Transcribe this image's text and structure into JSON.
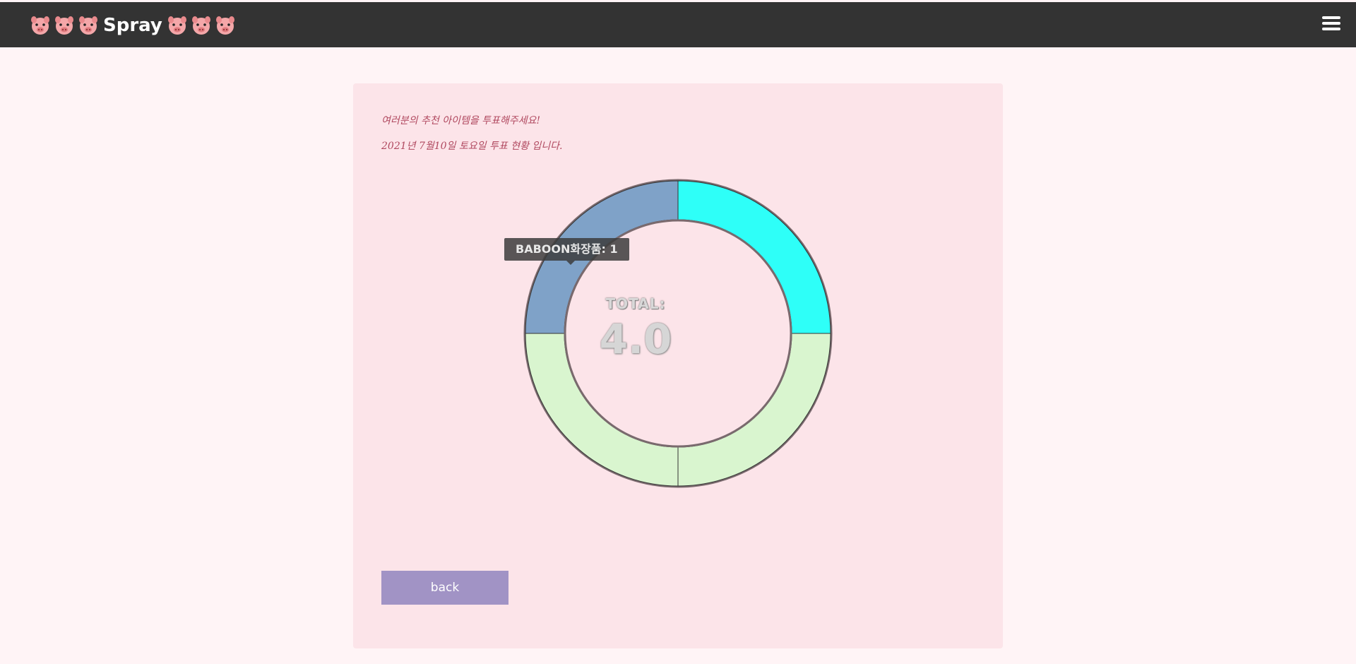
{
  "header": {
    "brand_text": "Spray",
    "icon_left": "pig-face-icon",
    "icon_right": "pig-face-icon",
    "menu_icon": "hamburger-menu-icon",
    "background": "#333333"
  },
  "card": {
    "intro_line1": "여러분의 추천 아이템을 투표해주세요!",
    "intro_line2": "2021년 7월10일 토요일 투표 현황 입니다."
  },
  "chart_data": {
    "type": "pie",
    "donut": true,
    "slices": [
      {
        "value": 1,
        "color": "#2efff8"
      },
      {
        "value": 1,
        "color": "#d9f5cf"
      },
      {
        "value": 1,
        "color": "#d9f5cf"
      },
      {
        "label": "BABOON화장품",
        "value": 1,
        "color": "#7fa2c8"
      }
    ],
    "total_label": "TOTAL:",
    "total_value": "4.0",
    "tooltip_text": "BABOON화장품: 1"
  },
  "buttons": {
    "back_label": "back"
  }
}
